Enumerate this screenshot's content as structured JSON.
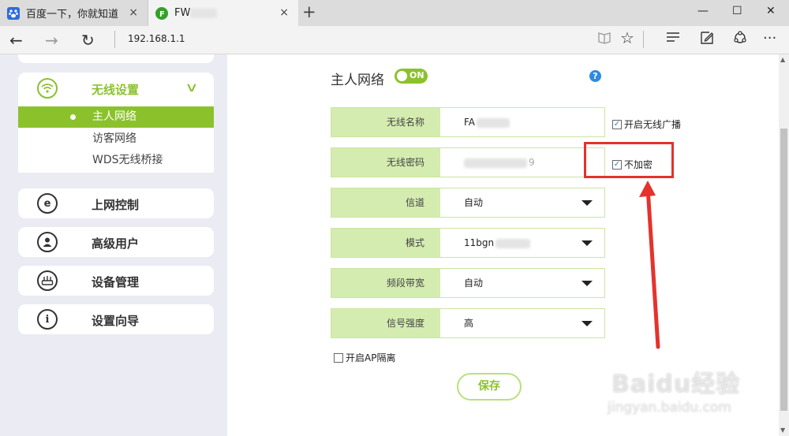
{
  "browser": {
    "tabs": [
      {
        "title": "百度一下，你就知道",
        "icon": "baidu-paw-icon",
        "close": "×"
      },
      {
        "title": "FW",
        "icon": "fast-router-icon",
        "close": "×"
      }
    ],
    "new_tab": "+",
    "window_controls": {
      "minimize": "—",
      "maximize": "☐",
      "close": "✕"
    },
    "url": "192.168.1.1",
    "nav": {
      "back": "←",
      "forward": "→",
      "refresh": "↻"
    },
    "toolbar_icons": {
      "reading_view": "📖",
      "favorite": "☆",
      "hub": "≡",
      "notes": "✎",
      "share": "⟳",
      "more": "···"
    }
  },
  "sidebar": {
    "wireless": {
      "label": "无线设置",
      "icon": "wifi-icon",
      "expanded": true
    },
    "submenu": [
      "主人网络",
      "访客网络",
      "WDS无线桥接"
    ],
    "active_submenu": 0,
    "items": [
      {
        "label": "上网控制",
        "icon": "internet-control-icon",
        "glyph": "e"
      },
      {
        "label": "高级用户",
        "icon": "user-icon",
        "glyph": "👤"
      },
      {
        "label": "设备管理",
        "icon": "router-icon",
        "glyph": "⊞"
      },
      {
        "label": "设置向导",
        "icon": "info-icon",
        "glyph": "i"
      }
    ]
  },
  "main": {
    "title": "主人网络",
    "toggle": "ON",
    "help": "?",
    "fields": [
      {
        "label": "无线名称",
        "value": "FA",
        "blurred": true
      },
      {
        "label": "无线密码",
        "value": "9",
        "blurred": true,
        "muted": true
      },
      {
        "label": "信道",
        "value": "自动",
        "dropdown": true
      },
      {
        "label": "模式",
        "value": "11bgn",
        "dropdown": true,
        "blurred": true
      },
      {
        "label": "频段带宽",
        "value": "自动",
        "dropdown": true
      },
      {
        "label": "信号强度",
        "value": "高",
        "dropdown": true
      }
    ],
    "broadcast_checkbox": {
      "label": "开启无线广播",
      "checked": true
    },
    "no_encrypt_checkbox": {
      "label": "不加密",
      "checked": true
    },
    "ap_isolation_checkbox": {
      "label": "开启AP隔离",
      "checked": false
    },
    "save_label": "保存"
  },
  "watermark": {
    "brand": "Baidu经验",
    "url": "jingyan.baidu.com"
  },
  "colors": {
    "accent": "#8bc22c",
    "highlight": "#e5322d",
    "label_bg": "#d4ecb0",
    "page_bg": "#eaebf3"
  }
}
